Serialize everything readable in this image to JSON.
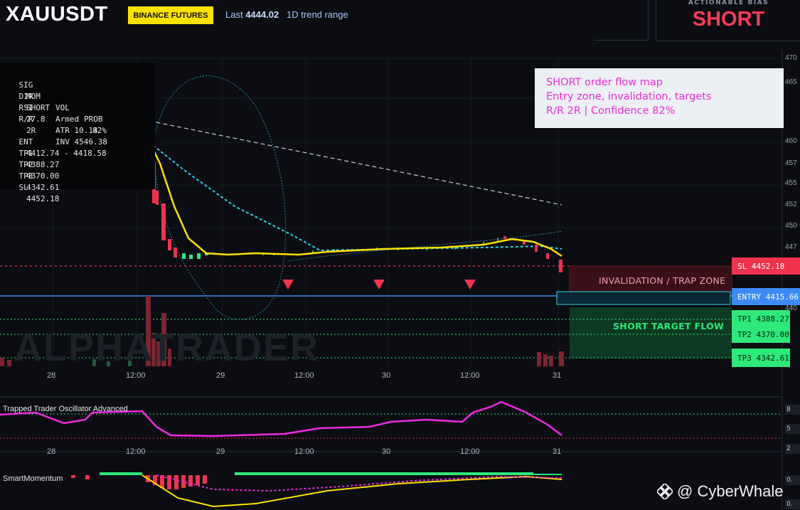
{
  "header": {
    "symbol": "XAUUSDT",
    "exchange_badge": "BINANCE FUTURES",
    "last_label": "Last",
    "last_value": "4444.02",
    "range_label": "1D trend range"
  },
  "bias": {
    "label": "ACTIONABLE BIAS",
    "value": "SHORT"
  },
  "stats_panel": {
    "rows": [
      [
        "SIG",
        "MOM",
        "VOL",
        "PROB"
      ],
      [
        "DIR",
        "SHORT",
        "Armed",
        "82%"
      ],
      [
        "RSI",
        "27.8",
        "ATR 10.14",
        ""
      ],
      [
        "R/R",
        "2R",
        "INV 4546.38",
        ""
      ],
      [
        "",
        "",
        "",
        ""
      ],
      [
        "ENT",
        "4412.74 - 4418.58",
        "",
        ""
      ],
      [
        "TP1",
        "4388.27",
        "",
        ""
      ],
      [
        "TP2",
        "4370.00",
        "",
        ""
      ],
      [
        "TP3",
        "4342.61",
        "",
        ""
      ],
      [
        "SL",
        "4452.18",
        "",
        ""
      ]
    ]
  },
  "note": {
    "line1": "SHORT order flow map",
    "line2": "Entry zone, invalidation, targets",
    "line3": "R/R 2R | Confidence 82%"
  },
  "levels": {
    "sl": "SL 4452.18",
    "entry": "ENTRY 4415.66",
    "tp1": "TP1 4388.27",
    "tp2": "TP2 4370.00",
    "tp3": "TP3 4342.61"
  },
  "zones": {
    "trap": "INVALIDATION / TRAP ZONE",
    "target": "SHORT TARGET FLOW"
  },
  "x_axis": [
    "28",
    "12:00",
    "29",
    "12:00",
    "30",
    "12:00",
    "31"
  ],
  "y_axis_main": [
    "470",
    "465",
    "460",
    "457",
    "455",
    "452",
    "450",
    "447",
    "440"
  ],
  "watermark": "ALPHATRADER",
  "oscillator": {
    "title": "Trapped Trader Oscillator Advanced",
    "scale": [
      "8",
      "5",
      "2"
    ]
  },
  "momentum": {
    "title": "SmartMomentum",
    "scale": [
      "0.",
      "0."
    ]
  },
  "credit": {
    "text": "@ CyberWhale"
  },
  "colors": {
    "bear": "#f0334d",
    "bull": "#2ee87a",
    "entry": "#3d8af5",
    "ema": "#ffe100",
    "cyan": "#2fd3e6",
    "magenta": "#ee2ae0"
  }
}
